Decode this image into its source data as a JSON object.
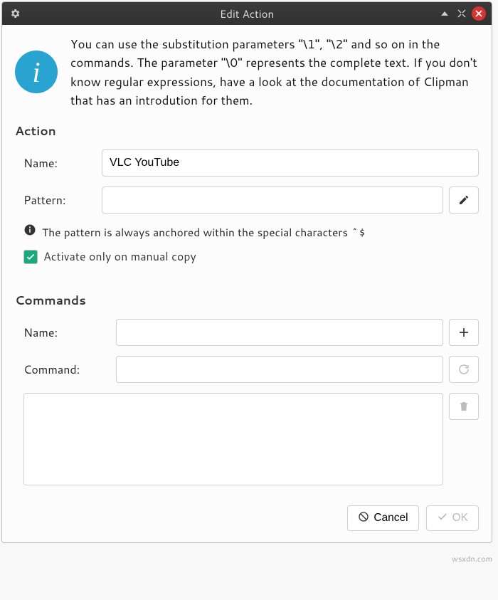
{
  "title": "Edit Action",
  "info_text": "You can use the substitution parameters \"\\1\", \"\\2\" and so on in the commands. The parameter \"\\0\" represents the complete text. If you don't know regular expressions, have a look at the documentation of Clipman that has an introdution for them.",
  "sections": {
    "action": {
      "title": "Action",
      "name_label": "Name:",
      "name_value": "VLC YouTube",
      "pattern_label": "Pattern:",
      "pattern_value": "",
      "anchor_note": "The pattern is always anchored within the special characters ^$",
      "activate_label": "Activate only on manual copy",
      "activate_checked": true
    },
    "commands": {
      "title": "Commands",
      "name_label": "Name:",
      "name_value": "",
      "command_label": "Command:",
      "command_value": ""
    }
  },
  "buttons": {
    "cancel_label": "Cancel",
    "ok_label": "OK"
  },
  "watermark": "wsxdn.com"
}
